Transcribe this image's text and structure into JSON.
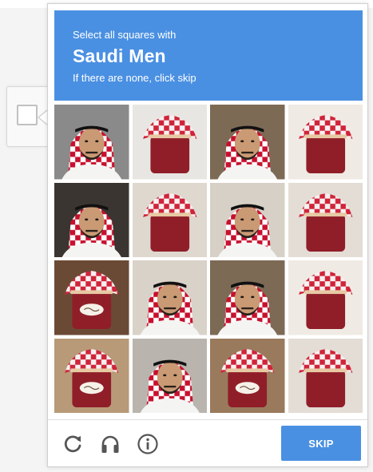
{
  "challenge": {
    "prompt_line1": "Select all squares with",
    "target": "Saudi Men",
    "prompt_line3": "If there are none, click skip"
  },
  "tiles": [
    {
      "row": 1,
      "col": 1,
      "content": "saudi-man"
    },
    {
      "row": 1,
      "col": 2,
      "content": "jam-jar"
    },
    {
      "row": 1,
      "col": 3,
      "content": "saudi-man"
    },
    {
      "row": 1,
      "col": 4,
      "content": "jam-jar"
    },
    {
      "row": 2,
      "col": 1,
      "content": "saudi-man"
    },
    {
      "row": 2,
      "col": 2,
      "content": "jam-jar"
    },
    {
      "row": 2,
      "col": 3,
      "content": "saudi-man"
    },
    {
      "row": 2,
      "col": 4,
      "content": "jam-jar"
    },
    {
      "row": 3,
      "col": 1,
      "content": "jam-jar"
    },
    {
      "row": 3,
      "col": 2,
      "content": "saudi-man"
    },
    {
      "row": 3,
      "col": 3,
      "content": "saudi-man"
    },
    {
      "row": 3,
      "col": 4,
      "content": "jam-jar"
    },
    {
      "row": 4,
      "col": 1,
      "content": "jam-jar"
    },
    {
      "row": 4,
      "col": 2,
      "content": "saudi-man"
    },
    {
      "row": 4,
      "col": 3,
      "content": "jam-jar"
    },
    {
      "row": 4,
      "col": 4,
      "content": "jam-jar"
    }
  ],
  "footer": {
    "refresh_icon": "refresh-icon",
    "audio_icon": "headphones-icon",
    "info_icon": "info-icon",
    "skip_label": "SKIP"
  },
  "colors": {
    "accent": "#4a90e2",
    "icon_gray": "#555555"
  }
}
